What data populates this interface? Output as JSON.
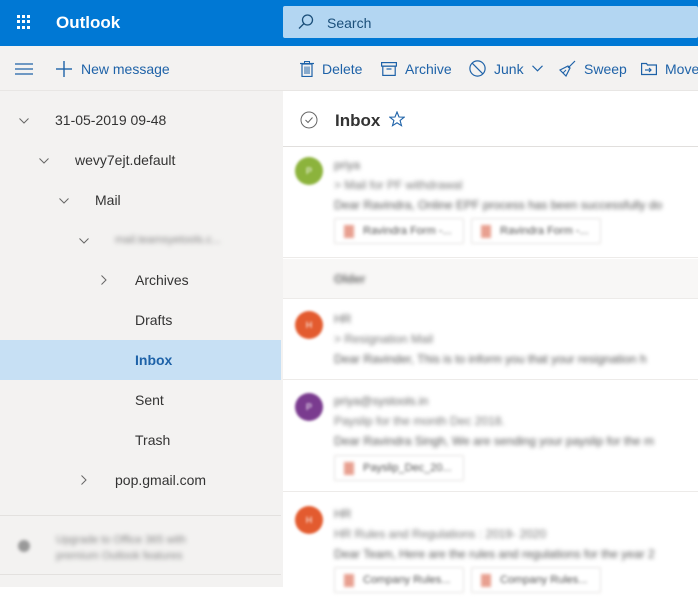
{
  "app": {
    "title": "Outlook",
    "brand_color": "#0078d4",
    "search_placeholder": "Search"
  },
  "toolbar": {
    "menu_icon": "hamburger-icon",
    "new_message": "New message",
    "actions": [
      {
        "label": "Delete",
        "icon": "trash-icon"
      },
      {
        "label": "Archive",
        "icon": "archive-icon"
      },
      {
        "label": "Junk",
        "icon": "block-icon",
        "has_dropdown": true
      },
      {
        "label": "Sweep",
        "icon": "broom-icon"
      },
      {
        "label": "Move",
        "icon": "move-icon"
      }
    ]
  },
  "sidebar": {
    "tree": [
      {
        "label": "31-05-2019 09-48",
        "expanded": true
      },
      {
        "label": "wevy7ejt.default",
        "expanded": true
      },
      {
        "label": "Mail",
        "expanded": true
      },
      {
        "label": "mail.teamsyetools.c...",
        "expanded": true,
        "blurred": true
      },
      {
        "label": "Archives",
        "expanded": false
      },
      {
        "label": "Drafts"
      },
      {
        "label": "Inbox",
        "selected": true
      },
      {
        "label": "Sent"
      },
      {
        "label": "Trash"
      },
      {
        "label": "pop.gmail.com",
        "expanded": false
      }
    ],
    "upsell": "Upgrade to Office 365 with premium Outlook features",
    "selected_color": "#c7e0f4"
  },
  "inbox": {
    "title": "Inbox",
    "section_older": "Older",
    "messages": [
      {
        "sender": "priya",
        "avatar_initial": "P",
        "avatar_color": "#8cb33c",
        "subject": "> Mail for PF withdrawal",
        "preview": "Dear Ravindra, Online EPF process has been successfully do",
        "attachments": [
          "Ravindra Form -...",
          "Ravindra Form -..."
        ]
      },
      {
        "sender": "HR",
        "avatar_initial": "H",
        "avatar_color": "#e35b2f",
        "subject": "> Resignation Mail",
        "preview": "Dear Ravinder, This is to inform you that your resignation h",
        "attachments": []
      },
      {
        "sender": "priya@systools.in",
        "avatar_initial": "P",
        "avatar_color": "#7a3b8f",
        "subject": "Payslip for the month Dec 2018.",
        "preview": "Dear Ravindra Singh, We are sending your payslip for the m",
        "attachments": [
          "Payslip_Dec_20..."
        ]
      },
      {
        "sender": "HR",
        "avatar_initial": "H",
        "avatar_color": "#e35b2f",
        "subject": "HR Rules and Regulations : 2019- 2020",
        "preview": "Dear Team, Here are the rules and regulations for the year 2",
        "attachments": [
          "Company Rules...",
          "Company Rules..."
        ]
      }
    ]
  }
}
